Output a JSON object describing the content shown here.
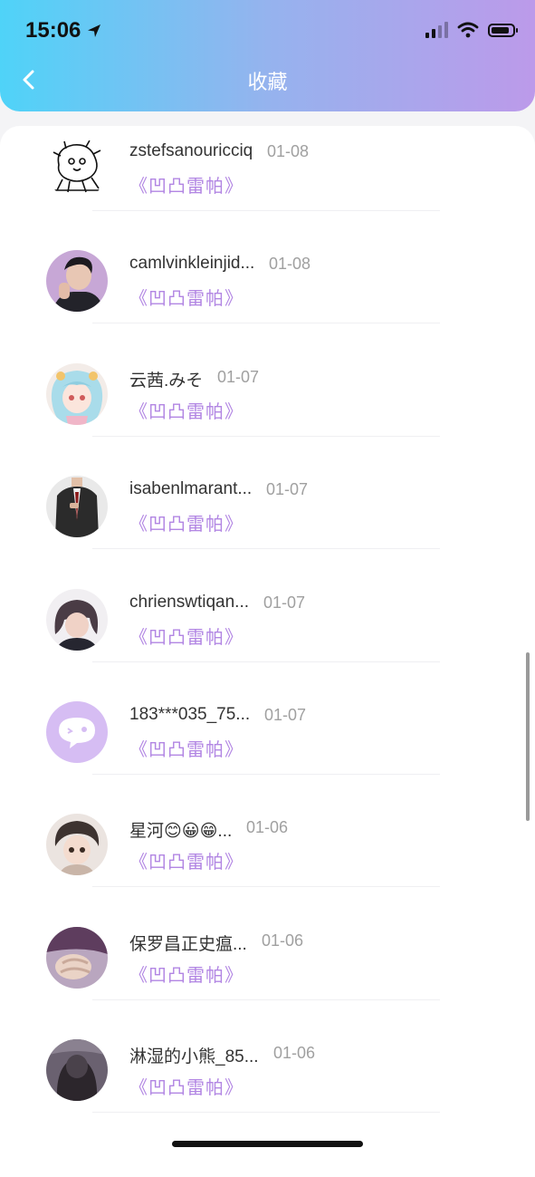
{
  "status_bar": {
    "time": "15:06",
    "battery_level": 0.85,
    "icons": [
      "location-arrow-icon",
      "signal-icon",
      "wifi-icon",
      "battery-icon"
    ]
  },
  "header": {
    "title": "收藏",
    "back_icon": "chevron-left-icon"
  },
  "colors": {
    "gradient_start": "#4fd3f8",
    "gradient_end": "#bc9aea",
    "accent_purple": "#b286e3"
  },
  "favorites": [
    {
      "name": "zstefsanouricciq",
      "date": "01-08",
      "work": "《凹凸雷帕》",
      "avatar": "lion-sketch"
    },
    {
      "name": "camlvinkleinjid...",
      "date": "01-08",
      "work": "《凹凸雷帕》",
      "avatar": "man-portrait"
    },
    {
      "name": "云茜.みそ",
      "date": "01-07",
      "work": "《凹凸雷帕》",
      "avatar": "anime-girl"
    },
    {
      "name": "isabenlmarant...",
      "date": "01-07",
      "work": "《凹凸雷帕》",
      "avatar": "suit-figure"
    },
    {
      "name": "chrienswtiqan...",
      "date": "01-07",
      "work": "《凹凸雷帕》",
      "avatar": "girl-short-hair"
    },
    {
      "name": "183***035_75...",
      "date": "01-07",
      "work": "《凹凸雷帕》",
      "avatar": "default-chat-bubble"
    },
    {
      "name": "星河😊😀😁...",
      "date": "01-06",
      "work": "《凹凸雷帕》",
      "avatar": "anime-boy"
    },
    {
      "name": "保罗昌正史瘟...",
      "date": "01-06",
      "work": "《凹凸雷帕》",
      "avatar": "holding-hands"
    },
    {
      "name": "淋湿的小熊_85...",
      "date": "01-06",
      "work": "《凹凸雷帕》",
      "avatar": "dark-figure"
    }
  ]
}
